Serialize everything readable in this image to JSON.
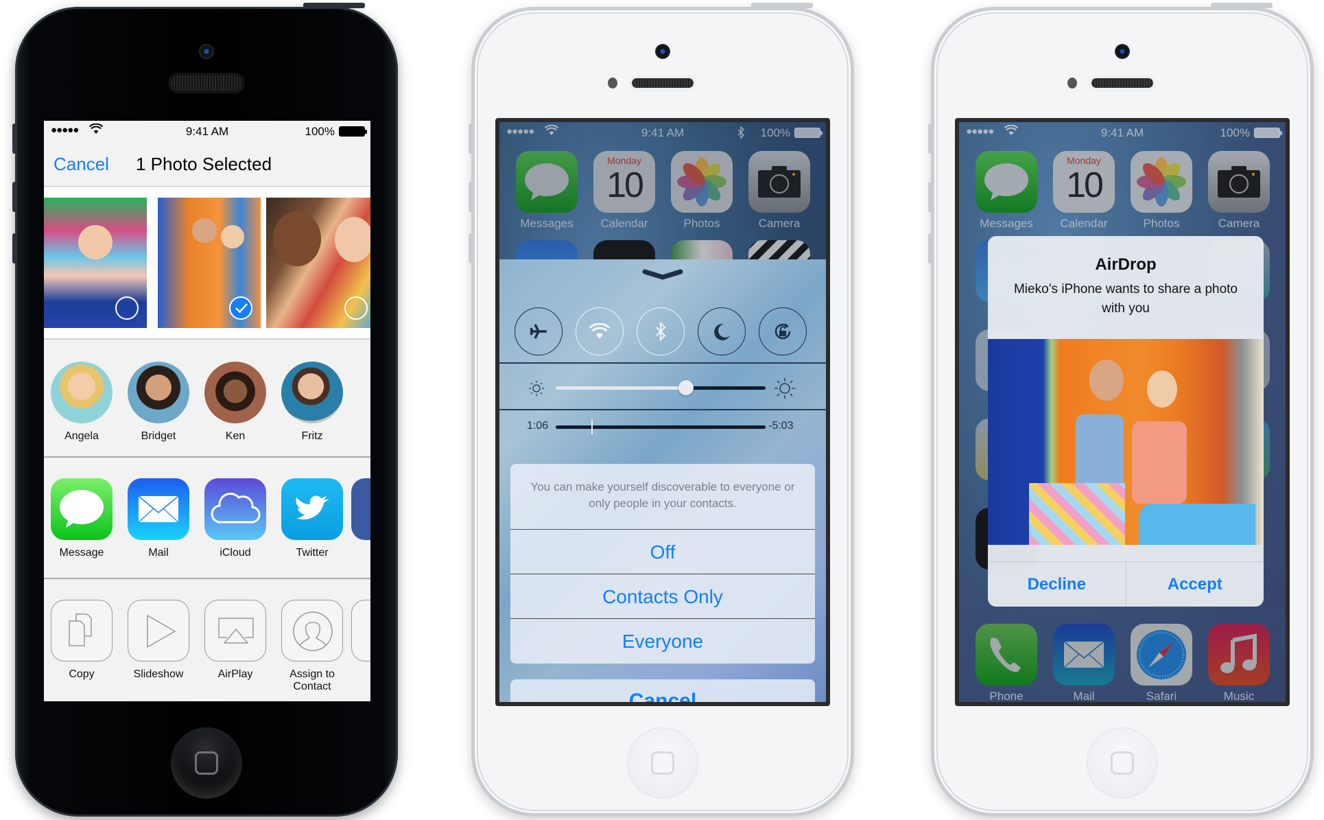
{
  "phones": [
    {
      "name": "iPhone 5 black — share sheet",
      "status": {
        "signal": "●●●●●",
        "time": "9:41 AM",
        "battery": "100%"
      },
      "navbar": {
        "cancel_label": "Cancel",
        "title": "1 Photo Selected"
      },
      "photos": [
        {
          "label": "photo-1",
          "selected": false
        },
        {
          "label": "photo-2",
          "selected": true
        },
        {
          "label": "photo-3",
          "selected": false
        }
      ],
      "people": [
        {
          "name": "Angela",
          "color": "#8fd3d8"
        },
        {
          "name": "Bridget",
          "color": "#6ea8c8"
        },
        {
          "name": "Ken",
          "color": "#8a5a44"
        },
        {
          "name": "Fritz",
          "color": "#2a7fa8"
        }
      ],
      "share_apps": [
        {
          "label": "Message",
          "icon": "message-bubble-icon",
          "color_top": "#79f06a",
          "color_bottom": "#0bc41b"
        },
        {
          "label": "Mail",
          "icon": "envelope-icon",
          "color_top": "#1d5df0",
          "color_bottom": "#19d4fb"
        },
        {
          "label": "iCloud",
          "icon": "cloud-icon",
          "color_top": "#5a4ad8",
          "color_bottom": "#5ac8f5"
        },
        {
          "label": "Twitter",
          "icon": "twitter-bird-icon",
          "color_top": "#1fbaf3",
          "color_bottom": "#0a9ee0"
        }
      ],
      "actions": [
        {
          "label": "Copy",
          "icon": "copy-icon"
        },
        {
          "label": "Slideshow",
          "icon": "play-icon"
        },
        {
          "label": "AirPlay",
          "icon": "airplay-icon"
        },
        {
          "label": "Assign to Contact",
          "icon": "contact-icon"
        }
      ]
    },
    {
      "name": "iPhone 5 white — Control Center AirDrop",
      "status": {
        "signal": "●●●●●",
        "time": "9:41 AM",
        "battery": "100%",
        "bluetooth": true
      },
      "home_apps": [
        {
          "label": "Messages",
          "icon": "messages-icon"
        },
        {
          "label": "Calendar",
          "icon": "calendar-icon",
          "day": "Monday",
          "date": "10"
        },
        {
          "label": "Photos",
          "icon": "photos-icon"
        },
        {
          "label": "Camera",
          "icon": "camera-icon"
        }
      ],
      "control_center": {
        "toggles": [
          {
            "name": "airplane-mode",
            "on": true
          },
          {
            "name": "wifi",
            "on": false
          },
          {
            "name": "bluetooth",
            "on": false
          },
          {
            "name": "do-not-disturb",
            "on": true
          },
          {
            "name": "rotation-lock",
            "on": true
          }
        ],
        "brightness": 0.62,
        "music": {
          "elapsed": "1:06",
          "remaining": "-5:03",
          "progress": 0.17
        }
      },
      "action_sheet": {
        "message": "You can make yourself discoverable to everyone or only people in your contacts.",
        "options": [
          "Off",
          "Contacts Only",
          "Everyone"
        ],
        "cancel_label": "Cancel"
      }
    },
    {
      "name": "iPhone 5 white — AirDrop request",
      "status": {
        "signal": "●●●●●",
        "time": "9:41 AM",
        "battery": "100%"
      },
      "home_apps": [
        {
          "label": "Messages",
          "icon": "messages-icon"
        },
        {
          "label": "Calendar",
          "icon": "calendar-icon",
          "day": "Monday",
          "date": "10"
        },
        {
          "label": "Photos",
          "icon": "photos-icon"
        },
        {
          "label": "Camera",
          "icon": "camera-icon"
        }
      ],
      "dock_apps": [
        {
          "label": "Phone",
          "icon": "phone-icon"
        },
        {
          "label": "Mail",
          "icon": "mail-icon"
        },
        {
          "label": "Safari",
          "icon": "safari-icon"
        },
        {
          "label": "Music",
          "icon": "music-icon"
        }
      ],
      "alert": {
        "title": "AirDrop",
        "message": "Mieko’s iPhone wants to share a photo with you",
        "decline_label": "Decline",
        "accept_label": "Accept"
      }
    }
  ],
  "colors": {
    "ios_blue": "#147efb",
    "calendar_red": "#d0313a"
  }
}
